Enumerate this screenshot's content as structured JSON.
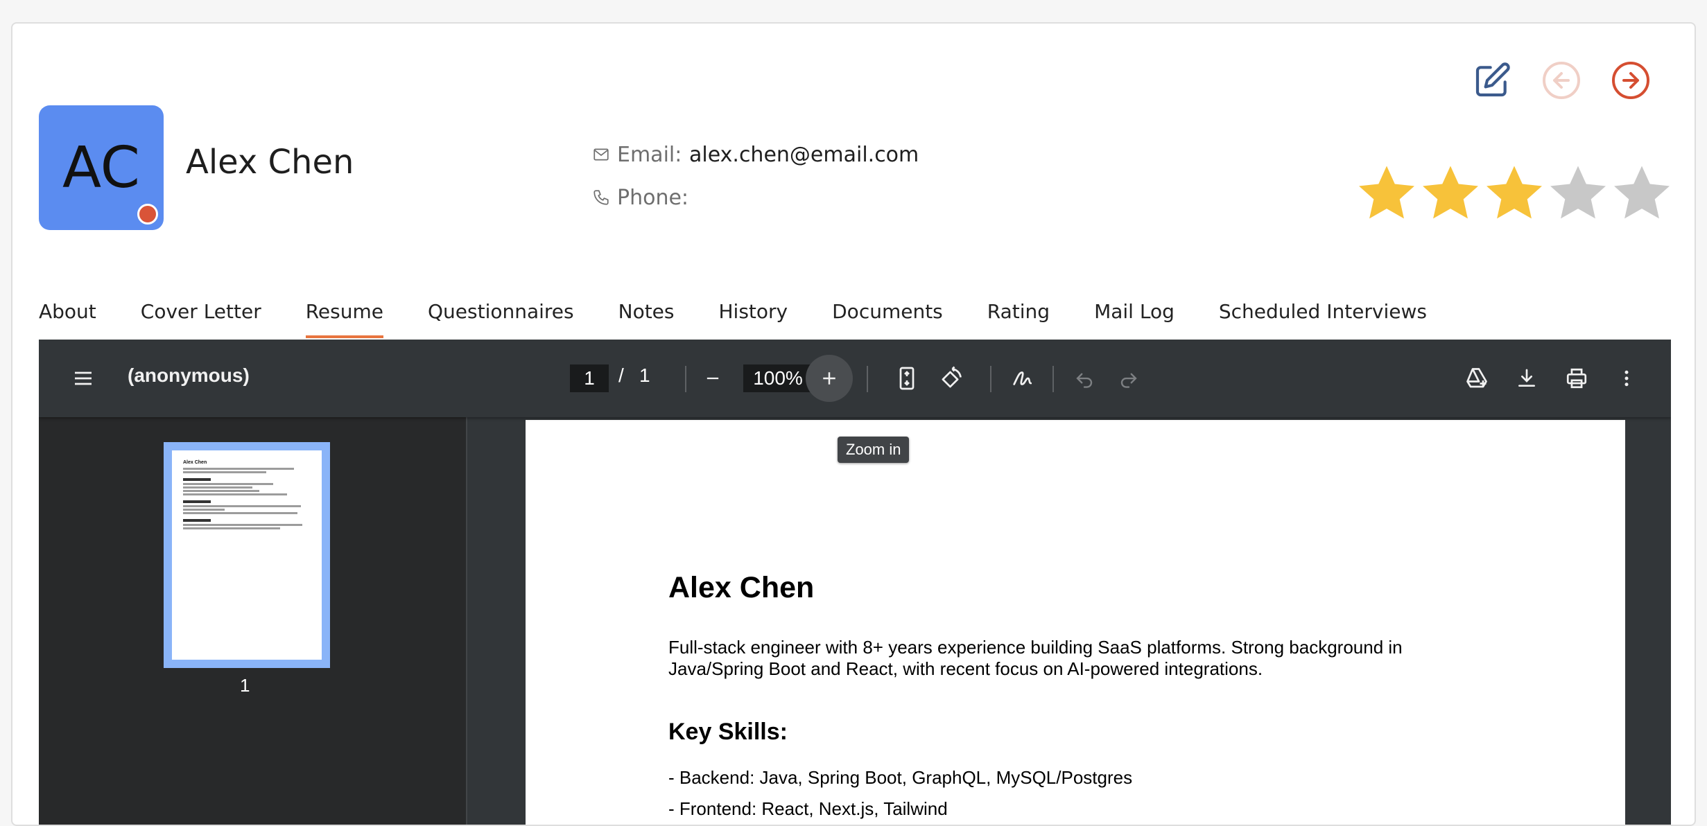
{
  "candidate": {
    "initials": "AC",
    "name": "Alex Chen",
    "email_label": "Email:",
    "email": "alex.chen@email.com",
    "phone_label": "Phone:",
    "phone": "",
    "rating": 3,
    "rating_max": 5,
    "status_color": "#d95438",
    "avatar_color": "#5b8cf0"
  },
  "actions": {
    "edit_icon": "edit-icon",
    "prev_icon": "arrow-left-circle-icon",
    "next_icon": "arrow-right-circle-icon"
  },
  "tabs": [
    {
      "label": "About",
      "active": false
    },
    {
      "label": "Cover Letter",
      "active": false
    },
    {
      "label": "Resume",
      "active": true
    },
    {
      "label": "Questionnaires",
      "active": false
    },
    {
      "label": "Notes",
      "active": false
    },
    {
      "label": "History",
      "active": false
    },
    {
      "label": "Documents",
      "active": false
    },
    {
      "label": "Rating",
      "active": false
    },
    {
      "label": "Mail Log",
      "active": false
    },
    {
      "label": "Scheduled Interviews",
      "active": false
    }
  ],
  "viewer": {
    "title": "(anonymous)",
    "page_current": "1",
    "page_separator": "/",
    "page_total": "1",
    "zoom": "100%",
    "tooltip": "Zoom in",
    "thumbnail_label": "1"
  },
  "resume": {
    "name": "Alex Chen",
    "summary": "Full-stack engineer with 8+ years experience building SaaS platforms. Strong background in Java/Spring Boot and React, with recent focus on AI-powered integrations.",
    "skills_heading": "Key Skills:",
    "skills": [
      "- Backend: Java, Spring Boot, GraphQL, MySQL/Postgres",
      "- Frontend: React, Next.js, Tailwind"
    ]
  }
}
